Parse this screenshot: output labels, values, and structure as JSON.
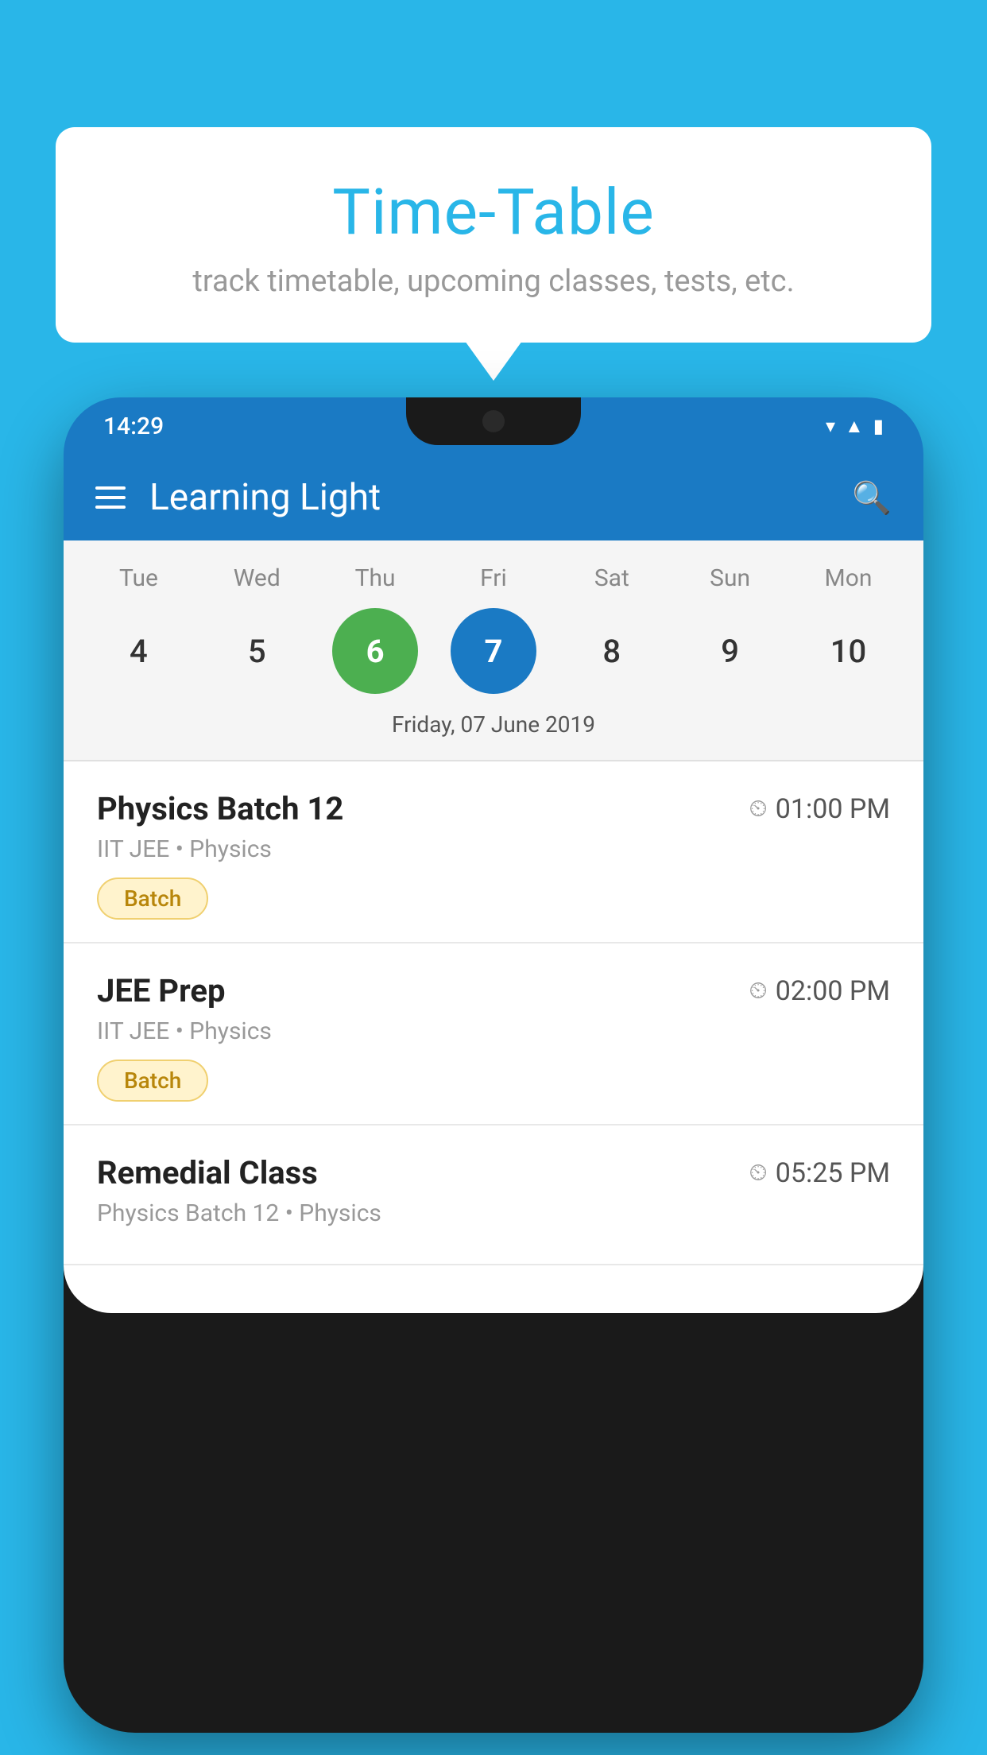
{
  "background_color": "#29b6e8",
  "speech_bubble": {
    "title": "Time-Table",
    "subtitle": "track timetable, upcoming classes, tests, etc."
  },
  "phone": {
    "status_bar": {
      "time": "14:29"
    },
    "app_bar": {
      "title": "Learning Light"
    },
    "calendar": {
      "days": [
        "Tue",
        "Wed",
        "Thu",
        "Fri",
        "Sat",
        "Sun",
        "Mon"
      ],
      "dates": [
        {
          "num": "4",
          "state": "normal"
        },
        {
          "num": "5",
          "state": "normal"
        },
        {
          "num": "6",
          "state": "today"
        },
        {
          "num": "7",
          "state": "selected"
        },
        {
          "num": "8",
          "state": "normal"
        },
        {
          "num": "9",
          "state": "normal"
        },
        {
          "num": "10",
          "state": "normal"
        }
      ],
      "selected_date_label": "Friday, 07 June 2019"
    },
    "schedule": [
      {
        "title": "Physics Batch 12",
        "time": "01:00 PM",
        "subtitle": "IIT JEE • Physics",
        "badge": "Batch"
      },
      {
        "title": "JEE Prep",
        "time": "02:00 PM",
        "subtitle": "IIT JEE • Physics",
        "badge": "Batch"
      },
      {
        "title": "Remedial Class",
        "time": "05:25 PM",
        "subtitle": "Physics Batch 12 • Physics",
        "badge": null
      }
    ]
  }
}
